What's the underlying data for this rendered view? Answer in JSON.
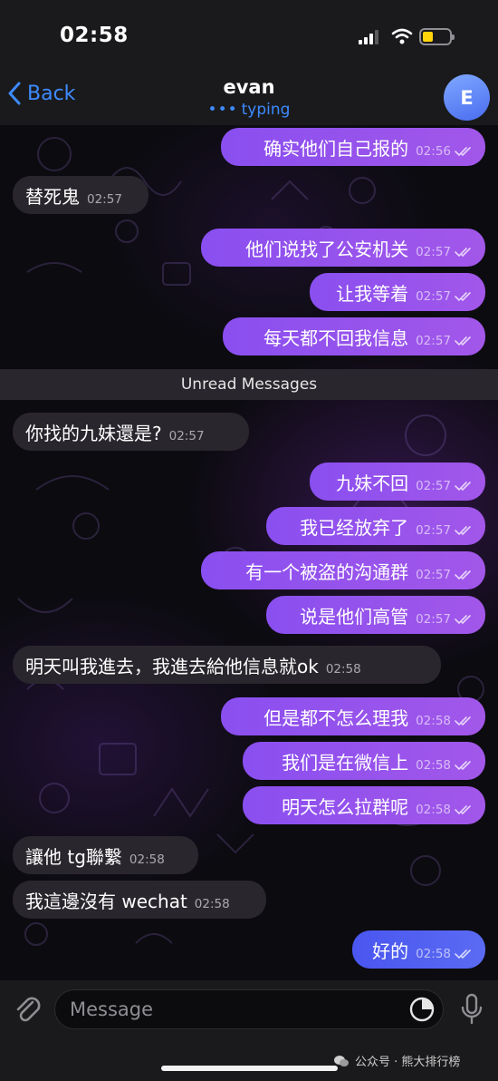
{
  "status_bar": {
    "time": "02:58"
  },
  "header": {
    "back_label": "Back",
    "title": "evan",
    "status": "typing",
    "avatar_letter": "E"
  },
  "messages": [
    {
      "dir": "out",
      "text": "确实他们自己报的",
      "time": "02:56"
    },
    {
      "dir": "in",
      "text": "替死鬼",
      "time": "02:57"
    },
    {
      "dir": "out",
      "text": "他们说找了公安机关",
      "time": "02:57"
    },
    {
      "dir": "out",
      "text": "让我等着",
      "time": "02:57"
    },
    {
      "dir": "out",
      "text": "每天都不回我信息",
      "time": "02:57"
    },
    {
      "dir": "in",
      "text": "你找的九妹還是?",
      "time": "02:57"
    },
    {
      "dir": "out",
      "text": "九妹不回",
      "time": "02:57"
    },
    {
      "dir": "out",
      "text": "我已经放弃了",
      "time": "02:57"
    },
    {
      "dir": "out",
      "text": "有一个被盗的沟通群",
      "time": "02:57"
    },
    {
      "dir": "out",
      "text": "说是他们高管",
      "time": "02:57"
    },
    {
      "dir": "in",
      "text": "明天叫我進去，我進去給他信息就ok",
      "time": "02:58"
    },
    {
      "dir": "out",
      "text": "但是都不怎么理我",
      "time": "02:58"
    },
    {
      "dir": "out",
      "text": "我们是在微信上",
      "time": "02:58"
    },
    {
      "dir": "out",
      "text": "明天怎么拉群呢",
      "time": "02:58"
    },
    {
      "dir": "in",
      "text": "讓他 tg聯繫",
      "time": "02:58"
    },
    {
      "dir": "in",
      "text": "我這邊沒有 wechat",
      "time": "02:58"
    },
    {
      "dir": "out",
      "text": "好的",
      "time": "02:58"
    }
  ],
  "unread_divider": "Unread Messages",
  "input": {
    "placeholder": "Message"
  },
  "watermark": "公众号 · 熊大排行榜",
  "colors": {
    "accent": "#3d8bff",
    "outgoing_bubble": "#9a55ee",
    "incoming_bubble": "#2a262d"
  }
}
